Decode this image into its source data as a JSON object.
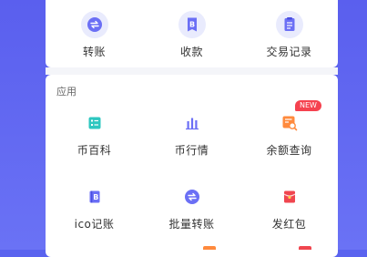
{
  "quick_actions": [
    {
      "label": "转账",
      "icon": "transfer-icon"
    },
    {
      "label": "收款",
      "icon": "receive-icon"
    },
    {
      "label": "交易记录",
      "icon": "records-icon"
    }
  ],
  "apps": {
    "section_title": "应用",
    "items": [
      {
        "label": "币百科",
        "icon": "coin-wiki-icon",
        "color": "#2ec7c0"
      },
      {
        "label": "币行情",
        "icon": "market-icon",
        "color": "#6b6ff5"
      },
      {
        "label": "余额查询",
        "icon": "balance-query-icon",
        "color": "#ff8a3d",
        "badge": "NEW"
      },
      {
        "label": "ico记账",
        "icon": "ico-ledger-icon",
        "color": "#6b6ff5"
      },
      {
        "label": "批量转账",
        "icon": "batch-transfer-icon",
        "color": "#6b6ff5"
      },
      {
        "label": "发红包",
        "icon": "red-packet-icon",
        "color": "#f0464f"
      }
    ]
  },
  "colors": {
    "accent": "#6b6ff5",
    "badge": "#f5424f",
    "background": "#5a63ef"
  }
}
